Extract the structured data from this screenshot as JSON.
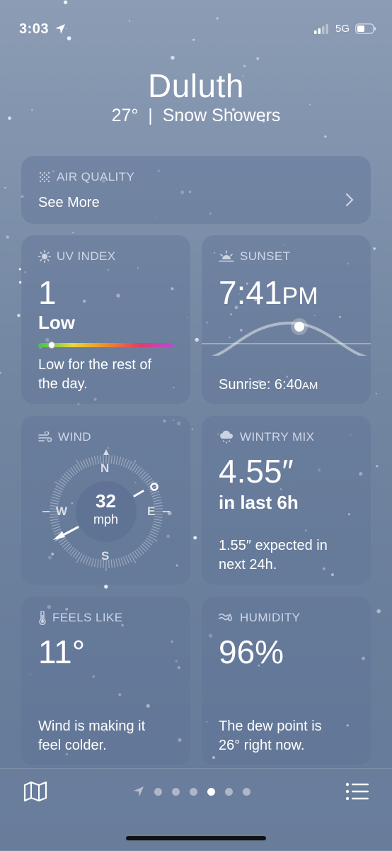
{
  "status": {
    "time": "3:03",
    "network": "5G"
  },
  "location": {
    "city": "Duluth",
    "temp": "27°",
    "separator": "|",
    "condition": "Snow Showers"
  },
  "air_quality": {
    "title": "AIR QUALITY",
    "link": "See More"
  },
  "uv": {
    "title": "UV INDEX",
    "value": "1",
    "level": "Low",
    "description_line1": "Low for the rest of",
    "description_line2": "the day.",
    "level_fraction": 0.1
  },
  "sunset": {
    "title": "SUNSET",
    "time": "7:41",
    "time_suffix": "PM",
    "sunrise_label": "Sunrise: 6:40",
    "sunrise_suffix": "AM"
  },
  "wind": {
    "title": "WIND",
    "speed": "32",
    "unit": "mph",
    "north": "N",
    "east": "E",
    "south": "S",
    "west": "W"
  },
  "wintry_mix": {
    "title": "WINTRY MIX",
    "amount": "4.55″",
    "period": "in last 6h",
    "description_line1": "1.55″ expected in",
    "description_line2": "next 24h."
  },
  "feels_like": {
    "title": "FEELS LIKE",
    "value": "11°",
    "description_line1": "Wind is making it",
    "description_line2": "feel colder."
  },
  "humidity": {
    "title": "HUMIDITY",
    "value": "96%",
    "description_line1": "The dew point is",
    "description_line2": "26° right now."
  },
  "pager": {
    "pages": 6,
    "active_index": 3
  },
  "colors": {
    "uv_gradient": [
      "#3ec24a",
      "#e6d83a",
      "#f08a2a",
      "#e23b6c",
      "#b54bd8"
    ]
  }
}
